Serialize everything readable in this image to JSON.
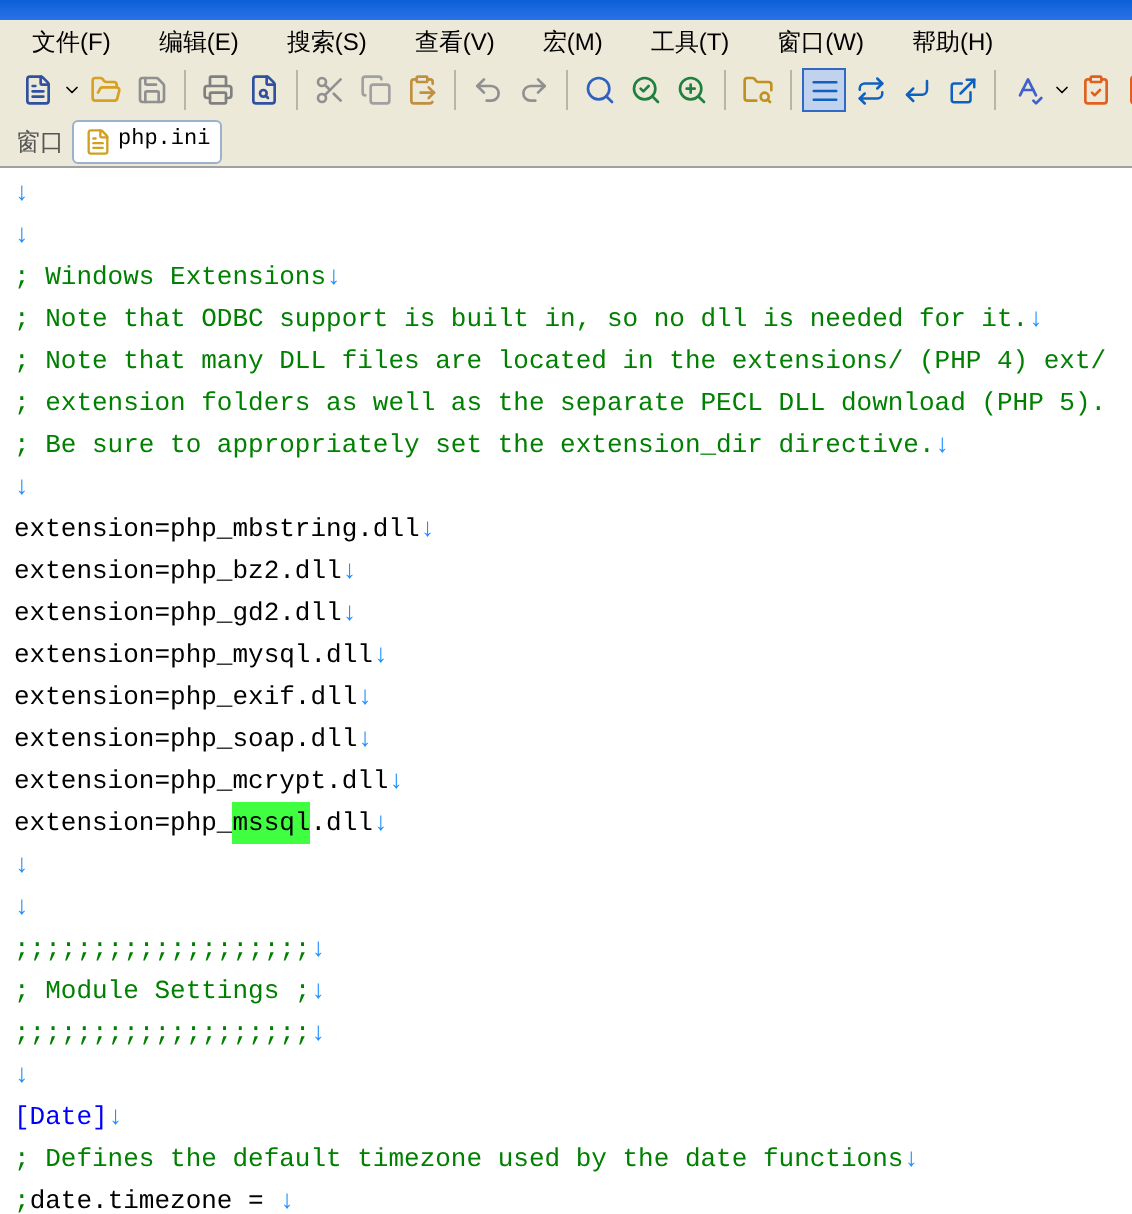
{
  "menu": [
    "文件(F)",
    "编辑(E)",
    "搜索(S)",
    "查看(V)",
    "宏(M)",
    "工具(T)",
    "窗口(W)",
    "帮助(H)"
  ],
  "toolbar": {
    "toggles": [
      {
        "pressed": true
      },
      {
        "pressed": false
      },
      {
        "pressed": false
      },
      {
        "pressed": false
      }
    ]
  },
  "window_bar": {
    "label": "窗口",
    "tabs": [
      {
        "label": "php.ini",
        "selected": true
      }
    ]
  },
  "lines": [
    {
      "eol": "↓"
    },
    {
      "eol": "↓"
    },
    {
      "parts": [
        {
          "kind": "comment",
          "text": "; Windows Extensions"
        }
      ],
      "eol": "↓"
    },
    {
      "parts": [
        {
          "kind": "comment",
          "text": "; Note that ODBC support is built in, so no dll is needed for it."
        }
      ],
      "eol": "↓"
    },
    {
      "parts": [
        {
          "kind": "comment",
          "text": "; Note that many DLL files are located in the extensions/ (PHP 4) ext/"
        }
      ]
    },
    {
      "parts": [
        {
          "kind": "comment",
          "text": "; extension folders as well as the separate PECL DLL download (PHP 5)."
        }
      ]
    },
    {
      "parts": [
        {
          "kind": "comment",
          "text": "; Be sure to appropriately set the extension_dir directive."
        }
      ],
      "eol": "↓"
    },
    {
      "eol": "↓"
    },
    {
      "parts": [
        {
          "kind": "code",
          "text": "extension=php_mbstring.dll"
        }
      ],
      "eol": "↓"
    },
    {
      "parts": [
        {
          "kind": "code",
          "text": "extension=php_bz2.dll"
        }
      ],
      "eol": "↓"
    },
    {
      "parts": [
        {
          "kind": "code",
          "text": "extension=php_gd2.dll"
        }
      ],
      "eol": "↓"
    },
    {
      "parts": [
        {
          "kind": "code",
          "text": "extension=php_mysql.dll"
        }
      ],
      "eol": "↓"
    },
    {
      "parts": [
        {
          "kind": "code",
          "text": "extension=php_exif.dll"
        }
      ],
      "eol": "↓"
    },
    {
      "parts": [
        {
          "kind": "code",
          "text": "extension=php_soap.dll"
        }
      ],
      "eol": "↓"
    },
    {
      "parts": [
        {
          "kind": "code",
          "text": "extension=php_mcrypt.dll"
        }
      ],
      "eol": "↓"
    },
    {
      "parts": [
        {
          "kind": "code",
          "text": "extension=php_"
        },
        {
          "kind": "highlight",
          "text": "mssql"
        },
        {
          "kind": "code",
          "text": ".dll"
        }
      ],
      "eol": "↓"
    },
    {
      "eol": "↓"
    },
    {
      "eol": "↓"
    },
    {
      "parts": [
        {
          "kind": "comment",
          "text": ";;;;;;;;;;;;;;;;;;;"
        }
      ],
      "eol": "↓"
    },
    {
      "parts": [
        {
          "kind": "comment",
          "text": "; Module Settings ;"
        }
      ],
      "eol": "↓"
    },
    {
      "parts": [
        {
          "kind": "comment",
          "text": ";;;;;;;;;;;;;;;;;;;"
        }
      ],
      "eol": "↓"
    },
    {
      "eol": "↓"
    },
    {
      "parts": [
        {
          "kind": "section",
          "text": "[Date]"
        }
      ],
      "eol": "↓"
    },
    {
      "parts": [
        {
          "kind": "comment",
          "text": "; Defines the default timezone used by the date functions"
        }
      ],
      "eol": "↓"
    },
    {
      "parts": [
        {
          "kind": "comment",
          "text": ";"
        },
        {
          "kind": "code",
          "text": "date.timezone = "
        }
      ],
      "eol": "↓"
    }
  ]
}
